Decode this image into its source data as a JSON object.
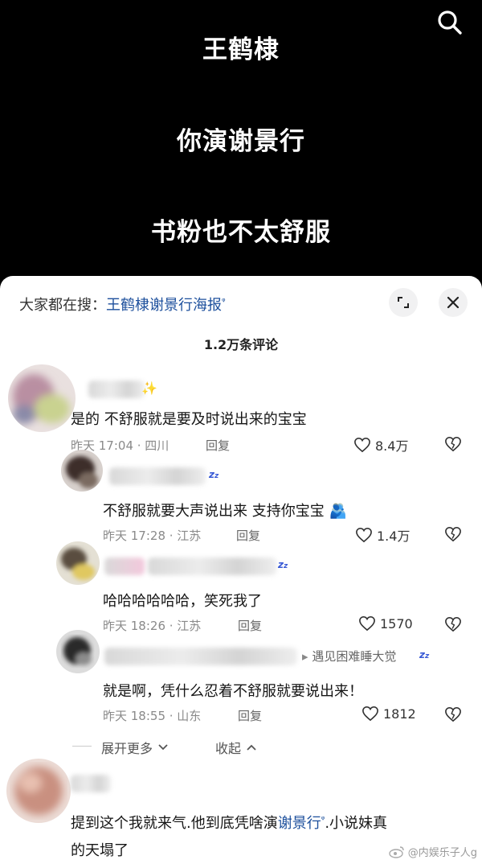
{
  "captions": [
    "王鹤棣",
    "你演谢景行",
    "书粉也不太舒服"
  ],
  "search_bar": {
    "prefix": "大家都在搜：",
    "keyword": "王鹤棣谢景行海报",
    "magnifier": "ᵠ"
  },
  "comment_count": "1.2万条评论",
  "comments": [
    {
      "text": "是的  不舒服就是要及时说出来的宝宝",
      "time": "昨天 17:04 · 四川",
      "reply": "回复",
      "likes": "8.4万"
    },
    {
      "text": "不舒服就要大声说出来 支持你宝宝",
      "emoji": "🫂",
      "time": "昨天 17:28 · 江苏",
      "reply": "回复",
      "likes": "1.4万"
    },
    {
      "text": "哈哈哈哈哈哈，笑死我了",
      "time": "昨天 18:26 · 江苏",
      "reply": "回复",
      "likes": "1570"
    },
    {
      "reply_to": "遇见困难睡大觉",
      "text": "就是啊，凭什么忍着不舒服就要说出来！",
      "time": "昨天 18:55 · 山东",
      "reply": "回复",
      "likes": "1812"
    }
  ],
  "zz": "z",
  "expand_more": "展开更多",
  "collapse": "收起",
  "last_comment": {
    "text_a": "提到这个我就来气.他到底凭啥演",
    "keyword": "谢景行",
    "magnifier": "ᵠ",
    "text_b": ".小说妹真",
    "text_c": "的天塌了"
  },
  "watermark": "@内娱乐子人g"
}
